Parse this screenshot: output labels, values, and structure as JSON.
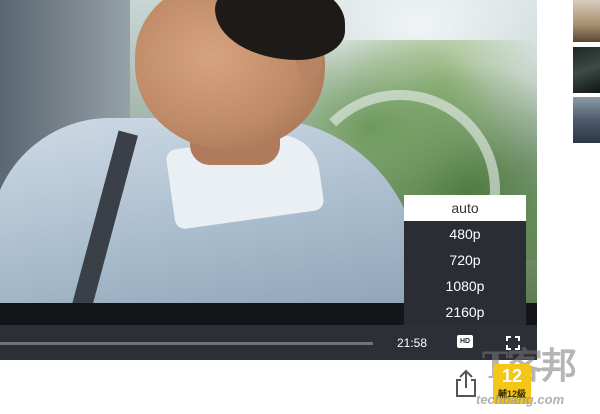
{
  "player": {
    "current_time": "21:58",
    "progress_fraction": 0.0,
    "hd_label": "HD",
    "quality_menu": {
      "options": [
        "auto",
        "480p",
        "720p",
        "1080p",
        "2160p"
      ],
      "selected": "auto"
    }
  },
  "sidebar_thumbnails": [
    {
      "icon": "video-thumbnail"
    },
    {
      "icon": "video-thumbnail"
    },
    {
      "icon": "video-thumbnail"
    }
  ],
  "footer": {
    "share_icon": "share-icon",
    "rating": {
      "number": "12",
      "label": "輔12級"
    },
    "watermark": {
      "logo_text": "T客邦",
      "url_text": "techbang.com"
    }
  },
  "colors": {
    "control_bar": "#2c2f36",
    "menu_bg": "#2a2d33",
    "menu_selected_bg": "#ffffff",
    "rating_badge": "#f5c518"
  }
}
